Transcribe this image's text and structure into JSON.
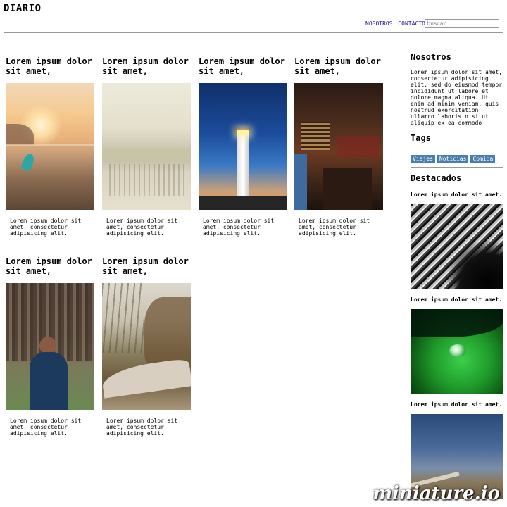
{
  "header": {
    "brand": "DIARIO",
    "nav": [
      "NOSOTROS",
      "CONTACTO"
    ],
    "search_placeholder": "buscar..."
  },
  "posts": [
    {
      "title": "Lorem ipsum dolor sit amet,",
      "excerpt": "Lorem ipsum dolor sit amet, consectetur adipisicing elit.",
      "image": "beach-sunset-surfboard"
    },
    {
      "title": "Lorem ipsum dolor sit amet,",
      "excerpt": "Lorem ipsum dolor sit amet, consectetur adipisicing elit.",
      "image": "crowded-beach"
    },
    {
      "title": "Lorem ipsum dolor sit amet,",
      "excerpt": "Lorem ipsum dolor sit amet, consectetur adipisicing elit.",
      "image": "lighthouse-night"
    },
    {
      "title": "Lorem ipsum dolor sit amet,",
      "excerpt": "Lorem ipsum dolor sit amet, consectetur adipisicing elit.",
      "image": "coffee-bar"
    },
    {
      "title": "Lorem ipsum dolor sit amet,",
      "excerpt": "Lorem ipsum dolor sit amet, consectetur adipisicing elit.",
      "image": "forest-person"
    },
    {
      "title": "Lorem ipsum dolor sit amet,",
      "excerpt": "Lorem ipsum dolor sit amet, consectetur adipisicing elit.",
      "image": "forest-road"
    }
  ],
  "sidebar": {
    "about_title": "Nosotros",
    "about_text": "Lorem ipsum dolor sit amet, consectetur adipisicing elit, sed do eiusmod tempor incididunt ut labore et dolore magna aliqua. Ut enim ad minim veniam, quis nostrud exercitation ullamco laboris nisi ut aliquip ex ea commodo",
    "tags_title": "Tags",
    "tags": [
      "Viajes",
      "Noticias",
      "Comida"
    ],
    "tag_color": "#4a7eb0",
    "featured_title": "Destacados",
    "featured": [
      {
        "title": "Lorem ipsum dolor sit amet.",
        "image": "abstract-architecture"
      },
      {
        "title": "Lorem ipsum dolor sit amet.",
        "image": "leaf-water-drop"
      },
      {
        "title": "Lorem ipsum dolor sit amet.",
        "image": "field-road-sky"
      }
    ]
  },
  "watermark": "miniature.io"
}
